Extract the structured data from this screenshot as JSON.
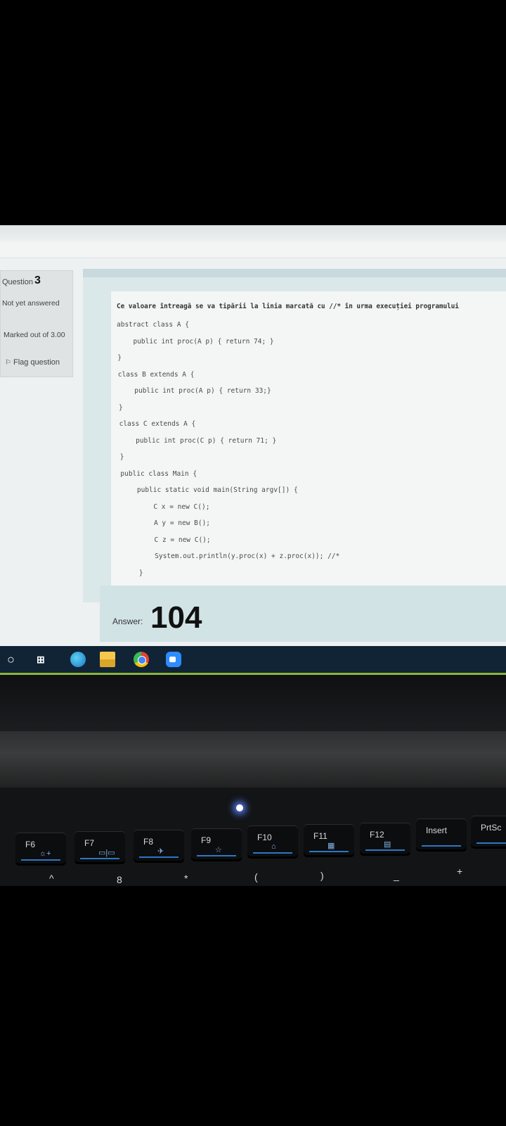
{
  "question": {
    "label": "Question",
    "number": "3",
    "status": "Not yet answered",
    "marked_out_of": "Marked out of 3.00",
    "flag_label": "Flag question"
  },
  "prompt": "Ce valoare întreagă se va tipării la linia marcată cu //* în urma execuției programului",
  "code_lines": [
    "abstract class A {",
    "    public int proc(A p) { return 74; }",
    "}",
    "class B extends A {",
    "    public int proc(A p) { return 33;}",
    "}",
    "class C extends A {",
    "    public int proc(C p) { return 71; }",
    "}",
    "public class Main {",
    "    public static void main(String argv[]) {",
    "        C x = new C();",
    "        A y = new B();",
    "        C z = new C();",
    "        System.out.println(y.proc(x) + z.proc(x)); //*",
    "    }",
    "}"
  ],
  "answer": {
    "label": "Answer:",
    "value": "104"
  },
  "taskbar": {
    "icons": [
      "start-icon",
      "task-view-icon",
      "edge-icon",
      "file-explorer-icon",
      "chrome-icon",
      "zoom-icon"
    ],
    "accent": "#8fb33a",
    "background": "#102436"
  },
  "keyboard": {
    "keys": [
      "F6",
      "F7",
      "F8",
      "F9",
      "F10",
      "F11",
      "F12",
      "Insert",
      "PrtSc"
    ],
    "glyphs": [
      "☼+",
      "▭|▭",
      "✈",
      "☆",
      "⌂",
      "▦",
      "▤"
    ],
    "lower_row": [
      "^",
      "8",
      "*",
      "(",
      ")",
      "_",
      "+"
    ]
  }
}
